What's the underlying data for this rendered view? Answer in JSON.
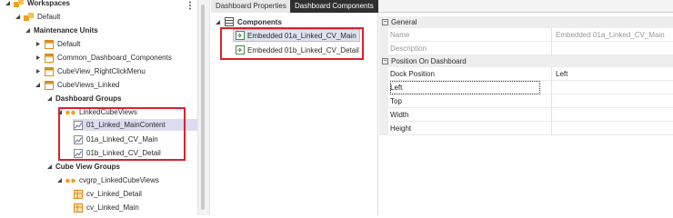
{
  "tree": {
    "items": [
      {
        "label": "Workspaces",
        "bold": true
      },
      {
        "label": "Default",
        "bold": false
      },
      {
        "label": "Maintenance Units",
        "bold": true
      },
      {
        "label": "Default",
        "bold": false
      },
      {
        "label": "Common_Dashboard_Components",
        "bold": false
      },
      {
        "label": "CubeView_RightClickMenu",
        "bold": false
      },
      {
        "label": "CubeViews_Linked",
        "bold": false
      },
      {
        "label": "Dashboard Groups",
        "bold": true
      },
      {
        "label": "LinkedCubeViews",
        "bold": false
      },
      {
        "label": "01_Linked_MainContent",
        "bold": false
      },
      {
        "label": "01a_Linked_CV_Main",
        "bold": false
      },
      {
        "label": "01b_Linked_CV_Detail",
        "bold": false
      },
      {
        "label": "Cube View Groups",
        "bold": true
      },
      {
        "label": "cvgrp_LinkedCubeViews",
        "bold": false
      },
      {
        "label": "cv_Linked_Detail",
        "bold": false
      },
      {
        "label": "cv_Linked_Main",
        "bold": false
      }
    ]
  },
  "tabs": [
    {
      "label": "Dashboard Properties",
      "active": false
    },
    {
      "label": "Dashboard Components",
      "active": true
    }
  ],
  "components": {
    "header": "Components",
    "items": [
      {
        "label": "Embedded 01a_Linked_CV_Main",
        "selected": true
      },
      {
        "label": "Embedded 01b_Linked_CV_Detail",
        "selected": false
      }
    ]
  },
  "properties": {
    "general": {
      "title": "General",
      "rows": [
        {
          "name": "Name",
          "value": "Embedded 01a_Linked_CV_Main"
        },
        {
          "name": "Description",
          "value": ""
        }
      ]
    },
    "position": {
      "title": "Position On Dashboard",
      "rows": [
        {
          "name": "Dock Position",
          "value": "Left"
        },
        {
          "name": "Left",
          "value": ""
        },
        {
          "name": "Top",
          "value": ""
        },
        {
          "name": "Width",
          "value": ""
        },
        {
          "name": "Height",
          "value": ""
        }
      ]
    }
  },
  "colors": {
    "highlight_box": "#e0202a",
    "folder": "#f0a020",
    "active_tab": "#2f2f2f"
  }
}
